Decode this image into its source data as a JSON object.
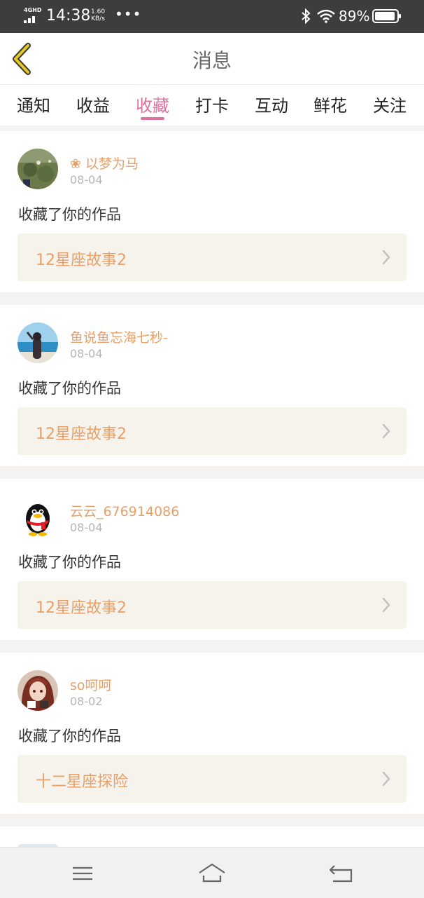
{
  "status_bar": {
    "network": "4GHD",
    "time": "14:38",
    "speed_value": "1.60",
    "speed_unit": "KB/s",
    "more": "•••",
    "battery": "89%"
  },
  "header": {
    "title": "消息",
    "back_icon": "chevron-left-icon"
  },
  "tabs": [
    {
      "label": "通知",
      "active": false
    },
    {
      "label": "收益",
      "active": false
    },
    {
      "label": "收藏",
      "active": true
    },
    {
      "label": "打卡",
      "active": false
    },
    {
      "label": "互动",
      "active": false
    },
    {
      "label": "鲜花",
      "active": false
    },
    {
      "label": "关注",
      "active": false
    }
  ],
  "notifications": [
    {
      "username": "❀ 以梦为马",
      "date": "08-04",
      "action": "收藏了你的作品",
      "work": "12星座故事2",
      "avatar": "landscape-avatar"
    },
    {
      "username": "鱼说鱼忘海七秒-",
      "date": "08-04",
      "action": "收藏了你的作品",
      "work": "12星座故事2",
      "avatar": "beach-avatar"
    },
    {
      "username": "云云_676914086",
      "date": "08-04",
      "action": "收藏了你的作品",
      "work": "12星座故事2",
      "avatar": "penguin-avatar"
    },
    {
      "username": "so呵呵",
      "date": "08-02",
      "action": "收藏了你的作品",
      "work": "十二星座探险",
      "avatar": "anime-avatar"
    }
  ],
  "colors": {
    "accent_pink": "#e0719c",
    "username_orange": "#e8a06a",
    "work_bg": "#f5f3ec",
    "back_icon_yellow": "#e6c72e"
  },
  "nav": {
    "menu_icon": "menu-icon",
    "home_icon": "home-icon",
    "back_icon": "return-icon"
  }
}
